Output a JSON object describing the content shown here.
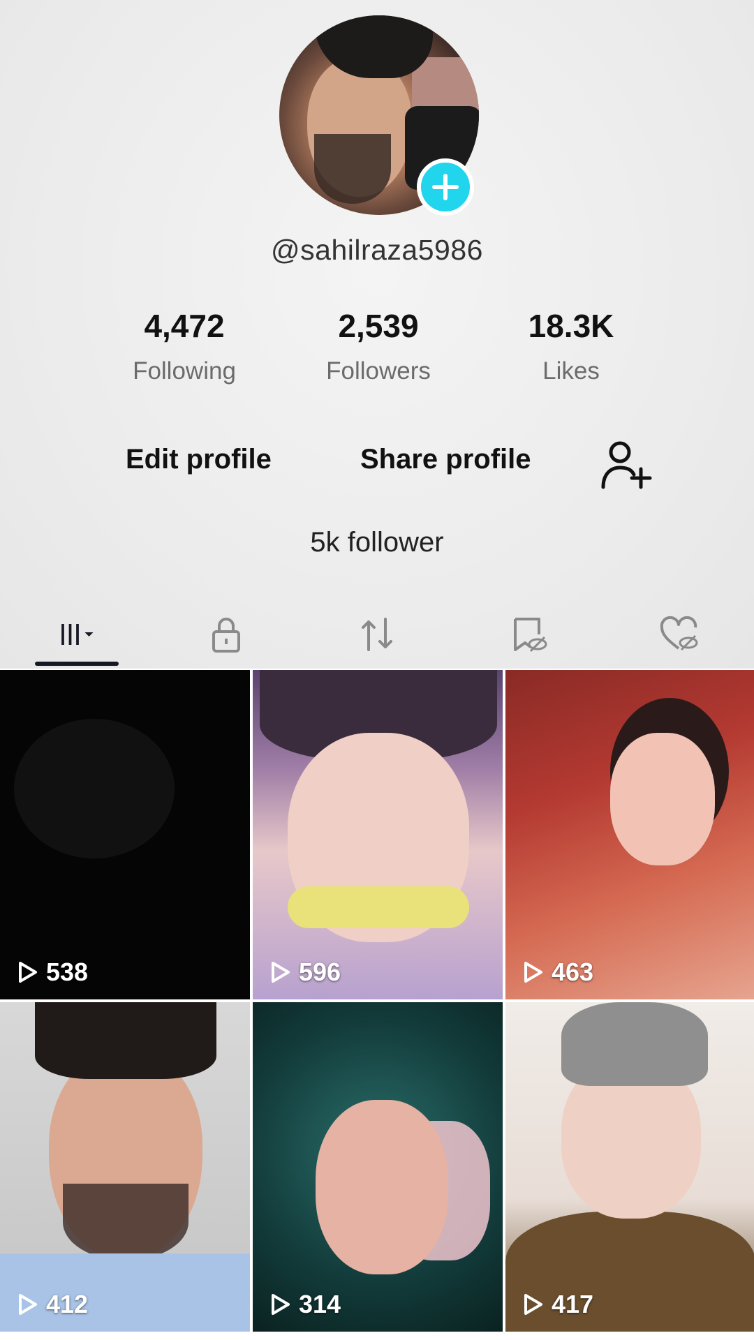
{
  "profile": {
    "username": "@sahilraza5986",
    "bio": "5k follower"
  },
  "stats": {
    "following": {
      "value": "4,472",
      "label": "Following"
    },
    "followers": {
      "value": "2,539",
      "label": "Followers"
    },
    "likes": {
      "value": "18.3K",
      "label": "Likes"
    }
  },
  "actions": {
    "edit_profile": "Edit profile",
    "share_profile": "Share profile"
  },
  "tabs": [
    {
      "icon": "videos-grid-icon",
      "active": true
    },
    {
      "icon": "lock-icon"
    },
    {
      "icon": "repost-icon"
    },
    {
      "icon": "favorites-hidden-icon"
    },
    {
      "icon": "liked-hidden-icon"
    }
  ],
  "videos": [
    {
      "views": "538"
    },
    {
      "views": "596"
    },
    {
      "views": "463"
    },
    {
      "views": "412"
    },
    {
      "views": "314"
    },
    {
      "views": "417"
    }
  ],
  "colors": {
    "accent": "#20d5ec",
    "text": "#161823",
    "secondary_text": "#6b6b6b"
  }
}
